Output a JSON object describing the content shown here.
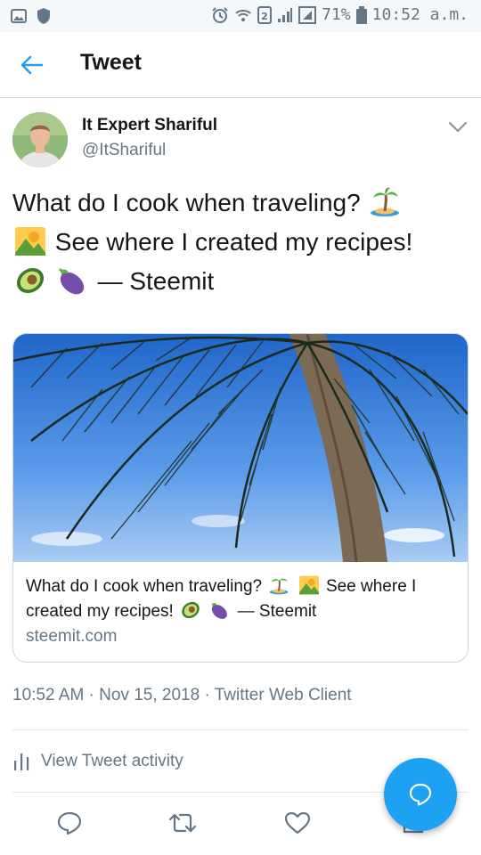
{
  "status_bar": {
    "battery": "71%",
    "time": "10:52 a.m."
  },
  "header": {
    "title": "Tweet"
  },
  "tweet": {
    "author_name": "It Expert Shariful",
    "author_handle": "@ItShariful",
    "text_line1": "What do I cook when traveling?",
    "text_line2": "See where I created my recipes!",
    "text_line3": "— Steemit",
    "card": {
      "title_part1": "What do I cook when traveling?",
      "title_part2": "See where I created my recipes!",
      "title_part3": "— Steemit",
      "domain": "steemit.com"
    },
    "meta": "10:52 AM · Nov 15, 2018 · Twitter Web Client",
    "activity_label": "View Tweet activity"
  },
  "colors": {
    "accent": "#1da1f2",
    "text": "#14171a",
    "secondary": "#657786",
    "border": "#ccd6dd"
  },
  "icons": {
    "back": "arrow-left-icon",
    "chevron": "chevron-down-icon",
    "reply": "reply-icon",
    "retweet": "retweet-icon",
    "like": "heart-icon",
    "share": "share-icon",
    "activity": "bar-chart-icon",
    "compose": "compose-reply-icon"
  }
}
